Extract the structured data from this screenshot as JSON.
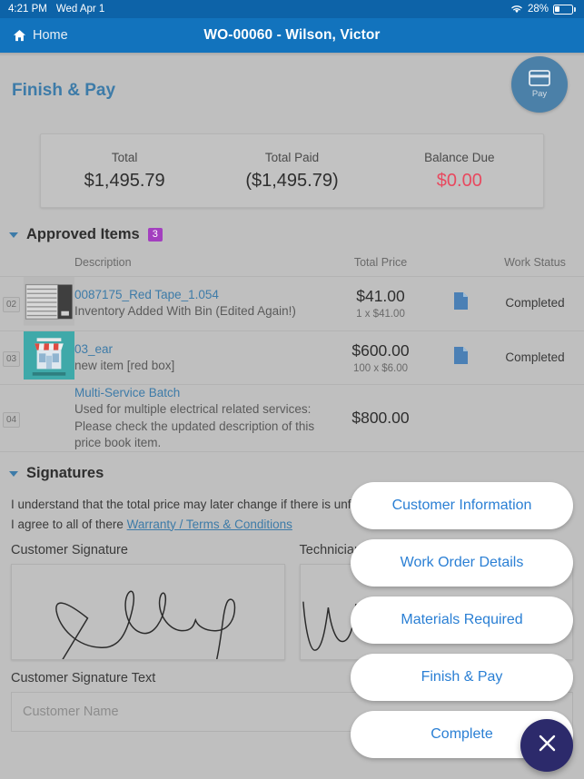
{
  "status_bar": {
    "time": "4:21 PM",
    "date": "Wed Apr 1",
    "battery_percent": "28%",
    "wifi_icon": "wifi-icon",
    "battery_icon": "battery-icon"
  },
  "nav": {
    "home_label": "Home",
    "home_icon": "home-icon",
    "title": "WO-00060 - Wilson, Victor"
  },
  "page": {
    "title": "Finish & Pay",
    "pay_button": {
      "label": "Pay",
      "icon": "credit-card-icon"
    }
  },
  "totals": [
    {
      "label": "Total",
      "value": "$1,495.79",
      "danger": false
    },
    {
      "label": "Total Paid",
      "value": "($1,495.79)",
      "danger": false
    },
    {
      "label": "Balance Due",
      "value": "$0.00",
      "danger": true
    }
  ],
  "approved_items": {
    "section_title": "Approved Items",
    "count_badge": "3",
    "columns": {
      "description": "Description",
      "total_price": "Total Price",
      "work_status": "Work Status"
    },
    "rows": [
      {
        "number": "02",
        "thumbnail": "air-conditioner-image",
        "title": "0087175_Red Tape_1.054",
        "subtitle": "Inventory Added With Bin (Edited Again!)",
        "price": "$41.00",
        "price_detail": "1 x $41.00",
        "doc_icon": "document-icon",
        "status": "Completed"
      },
      {
        "number": "03",
        "thumbnail": "storefront-image",
        "title": "03_ear",
        "subtitle": "new item [red box]",
        "price": "$600.00",
        "price_detail": "100 x $6.00",
        "doc_icon": "document-icon",
        "status": "Completed"
      },
      {
        "number": "04",
        "thumbnail": "none",
        "title": "Multi-Service Batch",
        "subtitle": "Used for multiple electrical related services: Please check the updated description of this price book item.",
        "price": "$800.00",
        "price_detail": "",
        "doc_icon": "document-icon",
        "status": ""
      }
    ]
  },
  "signatures": {
    "section_title": "Signatures",
    "agreement_line1": "I understand that the total price may later change if there is unforeseen work to be performed.",
    "agreement_line2_prefix": "I agree to all of there ",
    "agreement_link": "Warranty / Terms & Conditions",
    "customer_signature_label": "Customer Signature",
    "technician_signature_label": "Technician Signature",
    "customer_signature_text_label": "Customer Signature Text",
    "customer_name_placeholder": "Customer Name"
  },
  "speed_dial": {
    "items": [
      {
        "label": "Customer Information"
      },
      {
        "label": "Work Order Details"
      },
      {
        "label": "Materials Required"
      },
      {
        "label": "Finish & Pay"
      },
      {
        "label": "Complete"
      }
    ],
    "close_icon": "close-icon"
  },
  "colors": {
    "status_bar": "#0d63a8",
    "nav_bar": "#1273bd",
    "page_bg": "#bfbfbf",
    "accent_link": "#3d7ba8",
    "speed_dial_text": "#2a7fd4",
    "badge_purple": "#a33fbf",
    "danger_red": "#e8495f",
    "close_fab": "#2c2a6b",
    "pay_fab": "#4b80a8"
  }
}
